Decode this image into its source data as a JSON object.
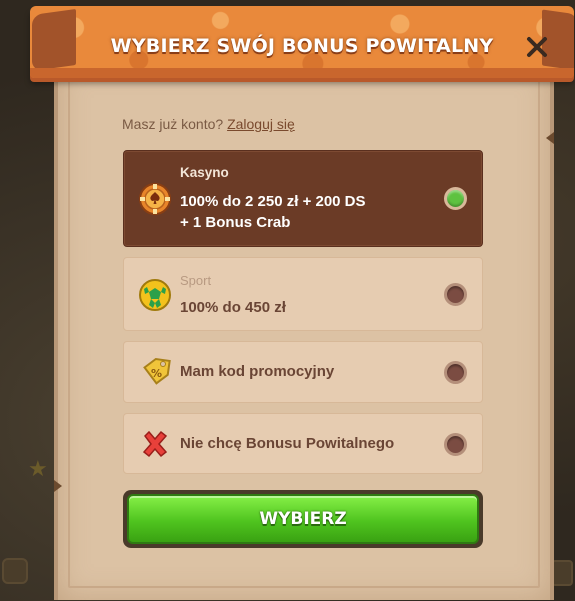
{
  "modal": {
    "title": "WYBIERZ SWÓJ BONUS POWITALNY",
    "close_icon": "close-icon"
  },
  "login": {
    "prompt": "Masz już konto?",
    "link": "Zaloguj się"
  },
  "options": [
    {
      "label": "Kasyno",
      "line1": "100% do 2 250 zł + 200 DS",
      "line2": "+ 1 Bonus Crab",
      "icon": "casino-chip-icon",
      "selected": true
    },
    {
      "label": "Sport",
      "line1": "100% do 450 zł",
      "icon": "soccer-ball-icon",
      "selected": false
    },
    {
      "line1": "Mam kod promocyjny",
      "icon": "promo-tag-icon",
      "selected": false
    },
    {
      "line1": "Nie chcę Bonusu Powitalnego",
      "icon": "red-x-icon",
      "selected": false
    }
  ],
  "cta": {
    "label": "WYBIERZ"
  },
  "colors": {
    "banner": "#e9893b",
    "parchment": "#dcc2a4",
    "selected_option": "#6b3b26",
    "radio_on": "#5ec240",
    "cta_green": "#4fc41f"
  }
}
